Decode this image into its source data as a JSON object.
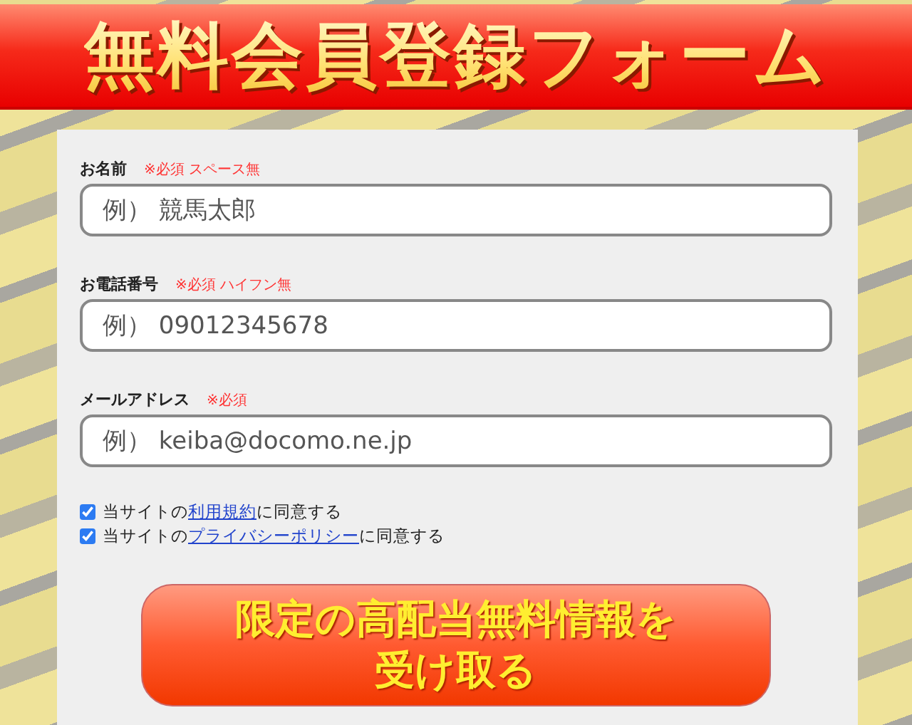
{
  "header": {
    "title": "無料会員登録フォーム"
  },
  "fields": [
    {
      "label": "お名前",
      "note": "※必須 スペース無",
      "placeholder": "例） 競馬太郎"
    },
    {
      "label": "お電話番号",
      "note": "※必須 ハイフン無",
      "placeholder": "例） 09012345678"
    },
    {
      "label": "メールアドレス",
      "note": "※必須",
      "placeholder": "例） keiba@docomo.ne.jp"
    }
  ],
  "agreements": [
    {
      "checked": true,
      "before": "当サイトの",
      "link": "利用規約",
      "after": "に同意する"
    },
    {
      "checked": true,
      "before": "当サイトの",
      "link": "プライバシーポリシー",
      "after": "に同意する"
    }
  ],
  "submit": {
    "lines": [
      "限定の高配当無料情報を",
      "受け取る"
    ]
  }
}
